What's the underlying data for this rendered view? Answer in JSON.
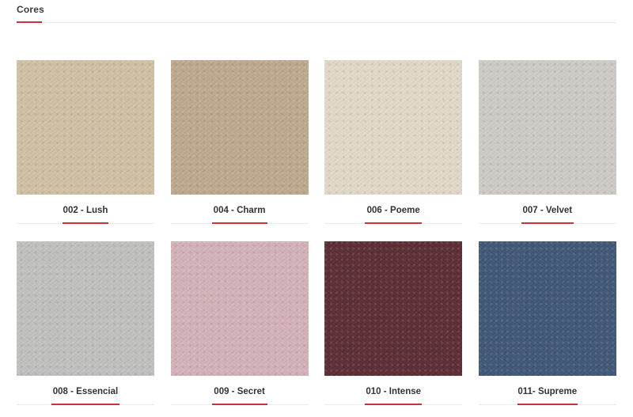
{
  "section": {
    "title": "Cores",
    "accent_color": "#c8323b"
  },
  "colors": [
    {
      "label": "002 - Lush",
      "swatch_color": "#d2c3a6"
    },
    {
      "label": "004 - Charm",
      "swatch_color": "#c0aa8f"
    },
    {
      "label": "006 - Poeme",
      "swatch_color": "#e3dccb"
    },
    {
      "label": "007 - Velvet",
      "swatch_color": "#d1ccc7"
    },
    {
      "label": "008 - Essencial",
      "swatch_color": "#c2c2c0"
    },
    {
      "label": "009 - Secret",
      "swatch_color": "#d6b4ba"
    },
    {
      "label": "010 - Intense",
      "swatch_color": "#5a2a31"
    },
    {
      "label": "011- Supreme",
      "swatch_color": "#3e5677"
    }
  ]
}
